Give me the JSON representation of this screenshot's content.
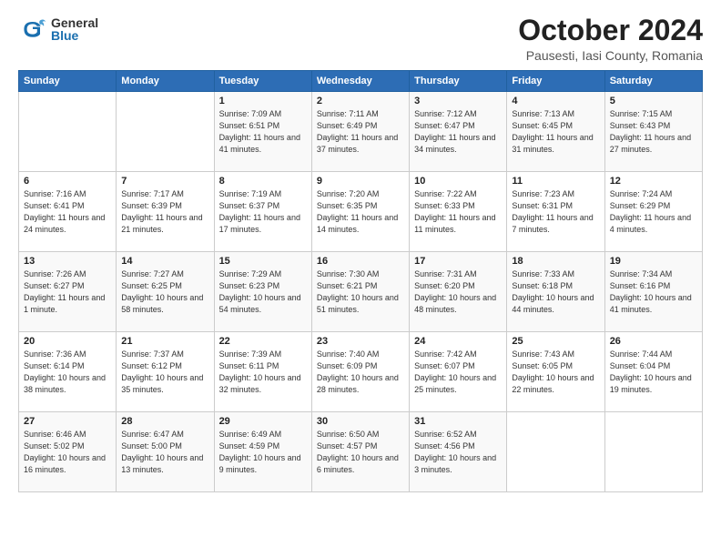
{
  "logo": {
    "general": "General",
    "blue": "Blue"
  },
  "header": {
    "month": "October 2024",
    "location": "Pausesti, Iasi County, Romania"
  },
  "weekdays": [
    "Sunday",
    "Monday",
    "Tuesday",
    "Wednesday",
    "Thursday",
    "Friday",
    "Saturday"
  ],
  "weeks": [
    [
      {
        "day": "",
        "info": ""
      },
      {
        "day": "",
        "info": ""
      },
      {
        "day": "1",
        "info": "Sunrise: 7:09 AM\nSunset: 6:51 PM\nDaylight: 11 hours and 41 minutes."
      },
      {
        "day": "2",
        "info": "Sunrise: 7:11 AM\nSunset: 6:49 PM\nDaylight: 11 hours and 37 minutes."
      },
      {
        "day": "3",
        "info": "Sunrise: 7:12 AM\nSunset: 6:47 PM\nDaylight: 11 hours and 34 minutes."
      },
      {
        "day": "4",
        "info": "Sunrise: 7:13 AM\nSunset: 6:45 PM\nDaylight: 11 hours and 31 minutes."
      },
      {
        "day": "5",
        "info": "Sunrise: 7:15 AM\nSunset: 6:43 PM\nDaylight: 11 hours and 27 minutes."
      }
    ],
    [
      {
        "day": "6",
        "info": "Sunrise: 7:16 AM\nSunset: 6:41 PM\nDaylight: 11 hours and 24 minutes."
      },
      {
        "day": "7",
        "info": "Sunrise: 7:17 AM\nSunset: 6:39 PM\nDaylight: 11 hours and 21 minutes."
      },
      {
        "day": "8",
        "info": "Sunrise: 7:19 AM\nSunset: 6:37 PM\nDaylight: 11 hours and 17 minutes."
      },
      {
        "day": "9",
        "info": "Sunrise: 7:20 AM\nSunset: 6:35 PM\nDaylight: 11 hours and 14 minutes."
      },
      {
        "day": "10",
        "info": "Sunrise: 7:22 AM\nSunset: 6:33 PM\nDaylight: 11 hours and 11 minutes."
      },
      {
        "day": "11",
        "info": "Sunrise: 7:23 AM\nSunset: 6:31 PM\nDaylight: 11 hours and 7 minutes."
      },
      {
        "day": "12",
        "info": "Sunrise: 7:24 AM\nSunset: 6:29 PM\nDaylight: 11 hours and 4 minutes."
      }
    ],
    [
      {
        "day": "13",
        "info": "Sunrise: 7:26 AM\nSunset: 6:27 PM\nDaylight: 11 hours and 1 minute."
      },
      {
        "day": "14",
        "info": "Sunrise: 7:27 AM\nSunset: 6:25 PM\nDaylight: 10 hours and 58 minutes."
      },
      {
        "day": "15",
        "info": "Sunrise: 7:29 AM\nSunset: 6:23 PM\nDaylight: 10 hours and 54 minutes."
      },
      {
        "day": "16",
        "info": "Sunrise: 7:30 AM\nSunset: 6:21 PM\nDaylight: 10 hours and 51 minutes."
      },
      {
        "day": "17",
        "info": "Sunrise: 7:31 AM\nSunset: 6:20 PM\nDaylight: 10 hours and 48 minutes."
      },
      {
        "day": "18",
        "info": "Sunrise: 7:33 AM\nSunset: 6:18 PM\nDaylight: 10 hours and 44 minutes."
      },
      {
        "day": "19",
        "info": "Sunrise: 7:34 AM\nSunset: 6:16 PM\nDaylight: 10 hours and 41 minutes."
      }
    ],
    [
      {
        "day": "20",
        "info": "Sunrise: 7:36 AM\nSunset: 6:14 PM\nDaylight: 10 hours and 38 minutes."
      },
      {
        "day": "21",
        "info": "Sunrise: 7:37 AM\nSunset: 6:12 PM\nDaylight: 10 hours and 35 minutes."
      },
      {
        "day": "22",
        "info": "Sunrise: 7:39 AM\nSunset: 6:11 PM\nDaylight: 10 hours and 32 minutes."
      },
      {
        "day": "23",
        "info": "Sunrise: 7:40 AM\nSunset: 6:09 PM\nDaylight: 10 hours and 28 minutes."
      },
      {
        "day": "24",
        "info": "Sunrise: 7:42 AM\nSunset: 6:07 PM\nDaylight: 10 hours and 25 minutes."
      },
      {
        "day": "25",
        "info": "Sunrise: 7:43 AM\nSunset: 6:05 PM\nDaylight: 10 hours and 22 minutes."
      },
      {
        "day": "26",
        "info": "Sunrise: 7:44 AM\nSunset: 6:04 PM\nDaylight: 10 hours and 19 minutes."
      }
    ],
    [
      {
        "day": "27",
        "info": "Sunrise: 6:46 AM\nSunset: 5:02 PM\nDaylight: 10 hours and 16 minutes."
      },
      {
        "day": "28",
        "info": "Sunrise: 6:47 AM\nSunset: 5:00 PM\nDaylight: 10 hours and 13 minutes."
      },
      {
        "day": "29",
        "info": "Sunrise: 6:49 AM\nSunset: 4:59 PM\nDaylight: 10 hours and 9 minutes."
      },
      {
        "day": "30",
        "info": "Sunrise: 6:50 AM\nSunset: 4:57 PM\nDaylight: 10 hours and 6 minutes."
      },
      {
        "day": "31",
        "info": "Sunrise: 6:52 AM\nSunset: 4:56 PM\nDaylight: 10 hours and 3 minutes."
      },
      {
        "day": "",
        "info": ""
      },
      {
        "day": "",
        "info": ""
      }
    ]
  ]
}
